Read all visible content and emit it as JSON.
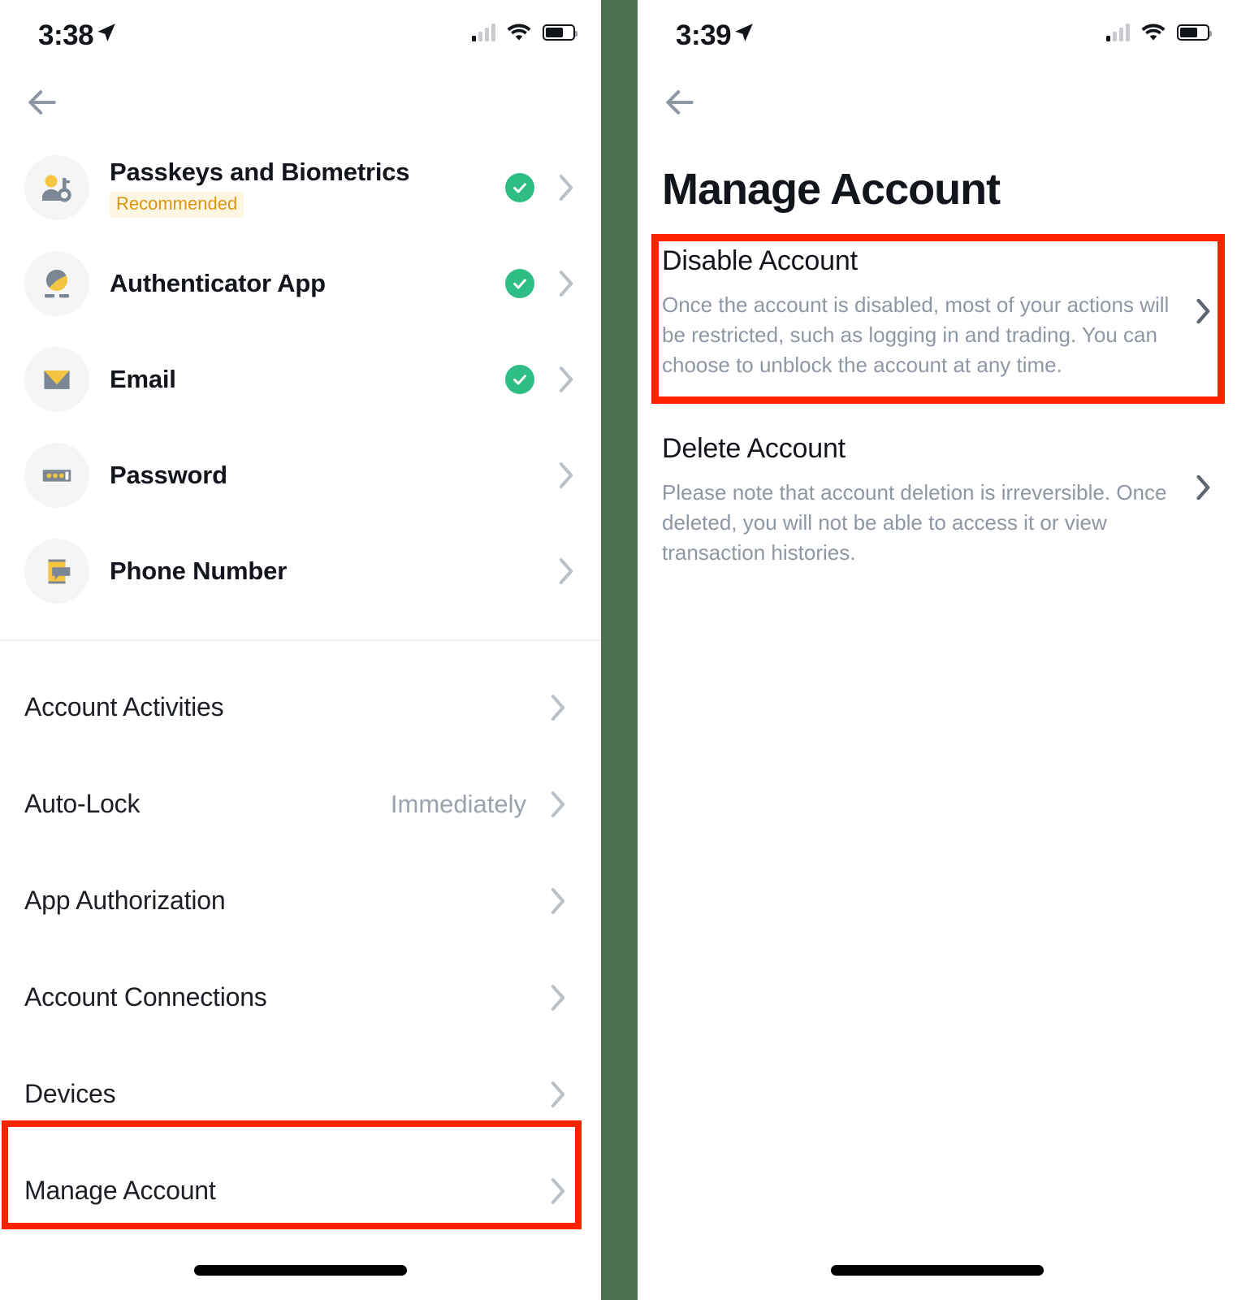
{
  "left_screen": {
    "status_bar": {
      "time": "3:38",
      "location_icon": "location-arrow-icon",
      "signal_icon": "cellular-signal-icon",
      "wifi_icon": "wifi-icon",
      "battery_icon": "battery-icon"
    },
    "back_button_icon": "back-arrow-icon",
    "security_items": [
      {
        "label": "Passkeys and Biometrics",
        "badge": "Recommended",
        "icon": "passkey-person-icon",
        "verified": true
      },
      {
        "label": "Authenticator App",
        "badge": "",
        "icon": "authenticator-pie-icon",
        "verified": true
      },
      {
        "label": "Email",
        "badge": "",
        "icon": "email-envelope-icon",
        "verified": true
      },
      {
        "label": "Password",
        "badge": "",
        "icon": "password-dots-icon",
        "verified": false
      },
      {
        "label": "Phone Number",
        "badge": "",
        "icon": "phone-message-icon",
        "verified": false
      }
    ],
    "settings_items": [
      {
        "label": "Account Activities",
        "value": ""
      },
      {
        "label": "Auto-Lock",
        "value": "Immediately"
      },
      {
        "label": "App Authorization",
        "value": ""
      },
      {
        "label": "Account Connections",
        "value": ""
      },
      {
        "label": "Devices",
        "value": ""
      },
      {
        "label": "Manage Account",
        "value": ""
      }
    ]
  },
  "right_screen": {
    "status_bar": {
      "time": "3:39",
      "location_icon": "location-arrow-icon",
      "signal_icon": "cellular-signal-icon",
      "wifi_icon": "wifi-icon",
      "battery_icon": "battery-icon"
    },
    "back_button_icon": "back-arrow-icon",
    "title": "Manage Account",
    "options": [
      {
        "title": "Disable Account",
        "description": "Once the account is disabled, most of your actions will be restricted, such as logging in and trading. You can choose to unblock the account at any time."
      },
      {
        "title": "Delete Account",
        "description": "Please note that account deletion is irreversible. Once deleted, you will not be able to access it or view transaction histories."
      }
    ]
  },
  "colors": {
    "highlight": "#ff2200",
    "divider_green": "#4a7150",
    "verified_green": "#2ebd85",
    "badge_text": "#d89614",
    "badge_bg": "#fdf6e3",
    "accent_yellow": "#f5c542",
    "icon_grey": "#7b8794"
  }
}
